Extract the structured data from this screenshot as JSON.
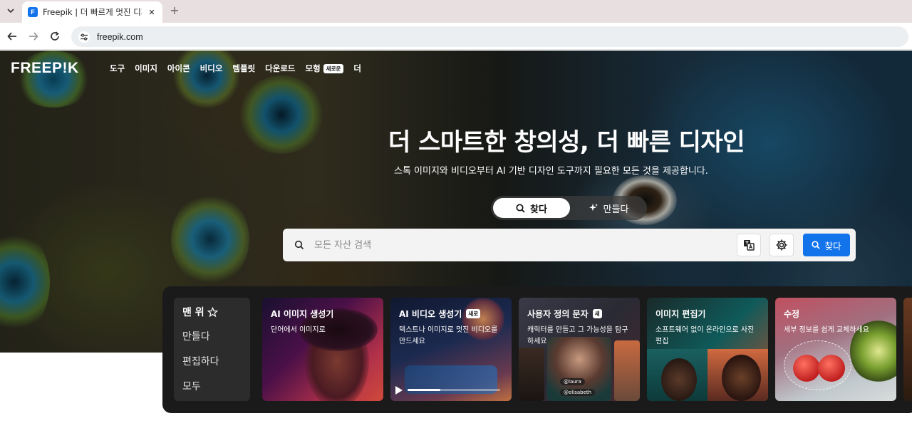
{
  "browser": {
    "tab_title": "Freepik | 더 빠르게 멋진 디자인",
    "url": "freepik.com"
  },
  "header": {
    "logo": "FREEP!K",
    "nav": [
      "도구",
      "이미지",
      "아이콘",
      "비디오",
      "템플릿",
      "다운로드"
    ],
    "nav_models": "모형",
    "nav_models_badge": "새로운",
    "nav_more": "더"
  },
  "hero": {
    "title": "더 스마트한 창의성, 더 빠른 디자인",
    "subtitle": "스톡 이미지와 비디오부터 AI 기반 디자인 도구까지 필요한 모든 것을 제공합니다.",
    "toggle_find": "찾다",
    "toggle_make": "만들다"
  },
  "search": {
    "placeholder": "모든 자산 검색",
    "submit_label": "찾다"
  },
  "panel": {
    "nav": [
      "맨 위",
      "만들다",
      "편집하다",
      "모두"
    ],
    "cards": [
      {
        "title": "AI 이미지 생성기",
        "desc": "단어에서 이미지로",
        "badge": ""
      },
      {
        "title": "AI 비디오 생성기",
        "desc": "텍스트나 이미지로 멋진 비디오를 만드세요",
        "badge": "새로"
      },
      {
        "title": "사용자 정의 문자",
        "desc": "캐릭터를 만들고 그 가능성을 탐구하세요",
        "badge": "새"
      },
      {
        "title": "이미지 편집기",
        "desc": "소프트웨어 없이 온라인으로 사진 편집",
        "badge": ""
      },
      {
        "title": "수정",
        "desc": "세부 정보를 쉽게 교체하세요",
        "badge": ""
      }
    ],
    "mini_tags": [
      "@laura",
      "@elisabeth"
    ]
  },
  "colors": {
    "accent": "#1273eb",
    "panel_bg": "#1a1a1a",
    "tabstrip_bg": "#e8dfe0"
  }
}
